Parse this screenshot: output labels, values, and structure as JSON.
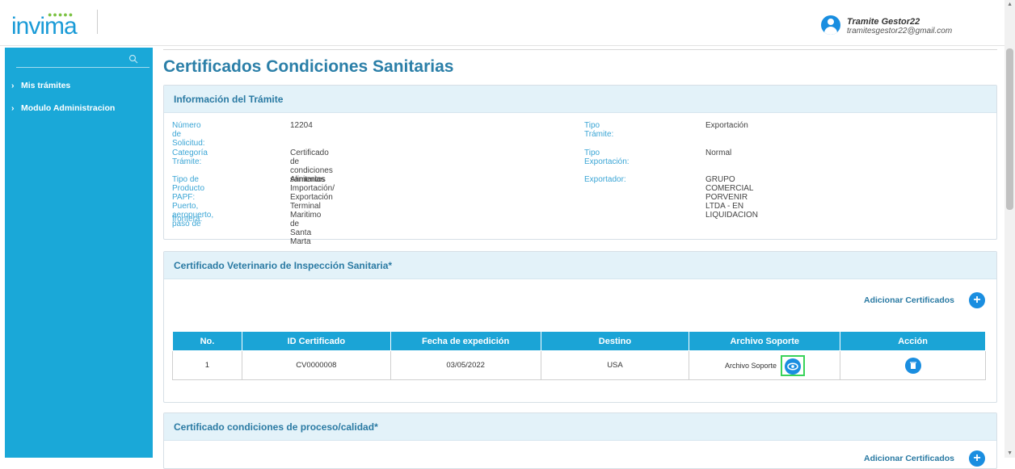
{
  "header": {
    "logo_text": "invima",
    "user_name": "Tramite Gestor22",
    "user_email": "tramitesgestor22@gmail.com"
  },
  "sidebar": {
    "items": [
      {
        "label": "Mis trámites"
      },
      {
        "label": "Modulo Administracion"
      }
    ]
  },
  "page_title": "Certificados Condiciones Sanitarias",
  "info_card": {
    "title": "Información del Trámite",
    "rows": [
      {
        "l1": "Número de Solicitud:",
        "v1": "12204",
        "l2": "Tipo Trámite:",
        "v2": "Exportación"
      },
      {
        "l1": "Categoría Trámite:",
        "v1": "Certificado de condiciones sanitarias Importación/ Exportación",
        "l2": "Tipo Exportación:",
        "v2": "Normal"
      },
      {
        "l1": "Tipo de Producto PAPF:",
        "v1": "Alimentos",
        "l2": "Exportador:",
        "v2": "GRUPO COMERCIAL PORVENIR LTDA - EN LIQUIDACION"
      },
      {
        "l1a": "Puerto, aeropuerto, paso de",
        "l1b": "frontera:",
        "v1": "Terminal Maritimo de Santa Marta"
      }
    ]
  },
  "vet_card": {
    "title": "Certificado Veterinario de Inspección Sanitaria*",
    "add_label": "Adicionar Certificados",
    "columns": [
      "No.",
      "ID Certificado",
      "Fecha de expedición",
      "Destino",
      "Archivo Soporte",
      "Acción"
    ],
    "rows": [
      {
        "no": "1",
        "id": "CV0000008",
        "fecha": "03/05/2022",
        "destino": "USA",
        "archivo": "Archivo Soporte"
      }
    ]
  },
  "process_card": {
    "title": "Certificado condiciones de proceso/calidad*",
    "add_label": "Adicionar Certificados"
  },
  "colors": {
    "accent": "#1aa8d8",
    "title": "#2b7fa8",
    "highlight": "#39d35a"
  }
}
